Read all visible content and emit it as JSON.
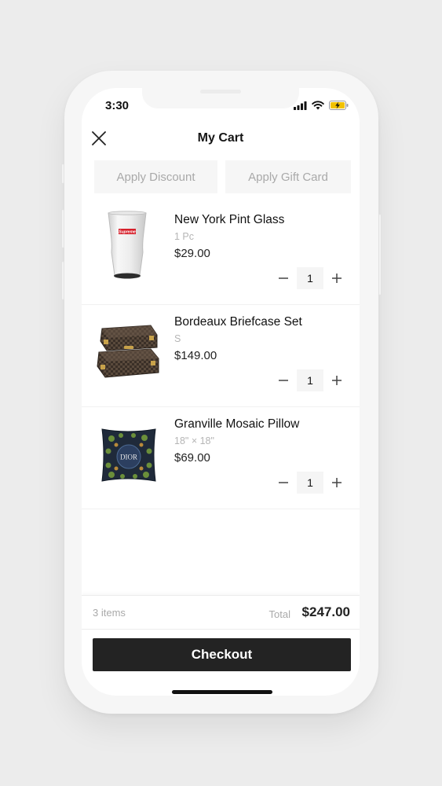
{
  "status": {
    "time": "3:30",
    "icons": [
      "cellular-signal-icon",
      "wifi-icon",
      "battery-charging-icon"
    ],
    "battery_color": "#f2c200"
  },
  "header": {
    "title": "My Cart",
    "close_icon": "close-icon"
  },
  "actions": {
    "discount_label": "Apply Discount",
    "giftcard_label": "Apply Gift Card"
  },
  "cart": {
    "items": [
      {
        "name": "New York Pint Glass",
        "variant": "1 Pc",
        "price": "$29.00",
        "quantity": "1",
        "image": "pint-glass-image"
      },
      {
        "name": "Bordeaux Briefcase Set",
        "variant": "S",
        "price": "$149.00",
        "quantity": "1",
        "image": "briefcase-set-image"
      },
      {
        "name": "Granville Mosaic Pillow",
        "variant": "18\" × 18\"",
        "price": "$69.00",
        "quantity": "1",
        "image": "mosaic-pillow-image"
      }
    ]
  },
  "product_marks": {
    "glass_label": "Supreme",
    "pillow_label": "DIOR"
  },
  "summary": {
    "item_count": "3 items",
    "total_label": "Total",
    "total_value": "$247.00"
  },
  "checkout": {
    "label": "Checkout",
    "button_color": "#232323"
  }
}
